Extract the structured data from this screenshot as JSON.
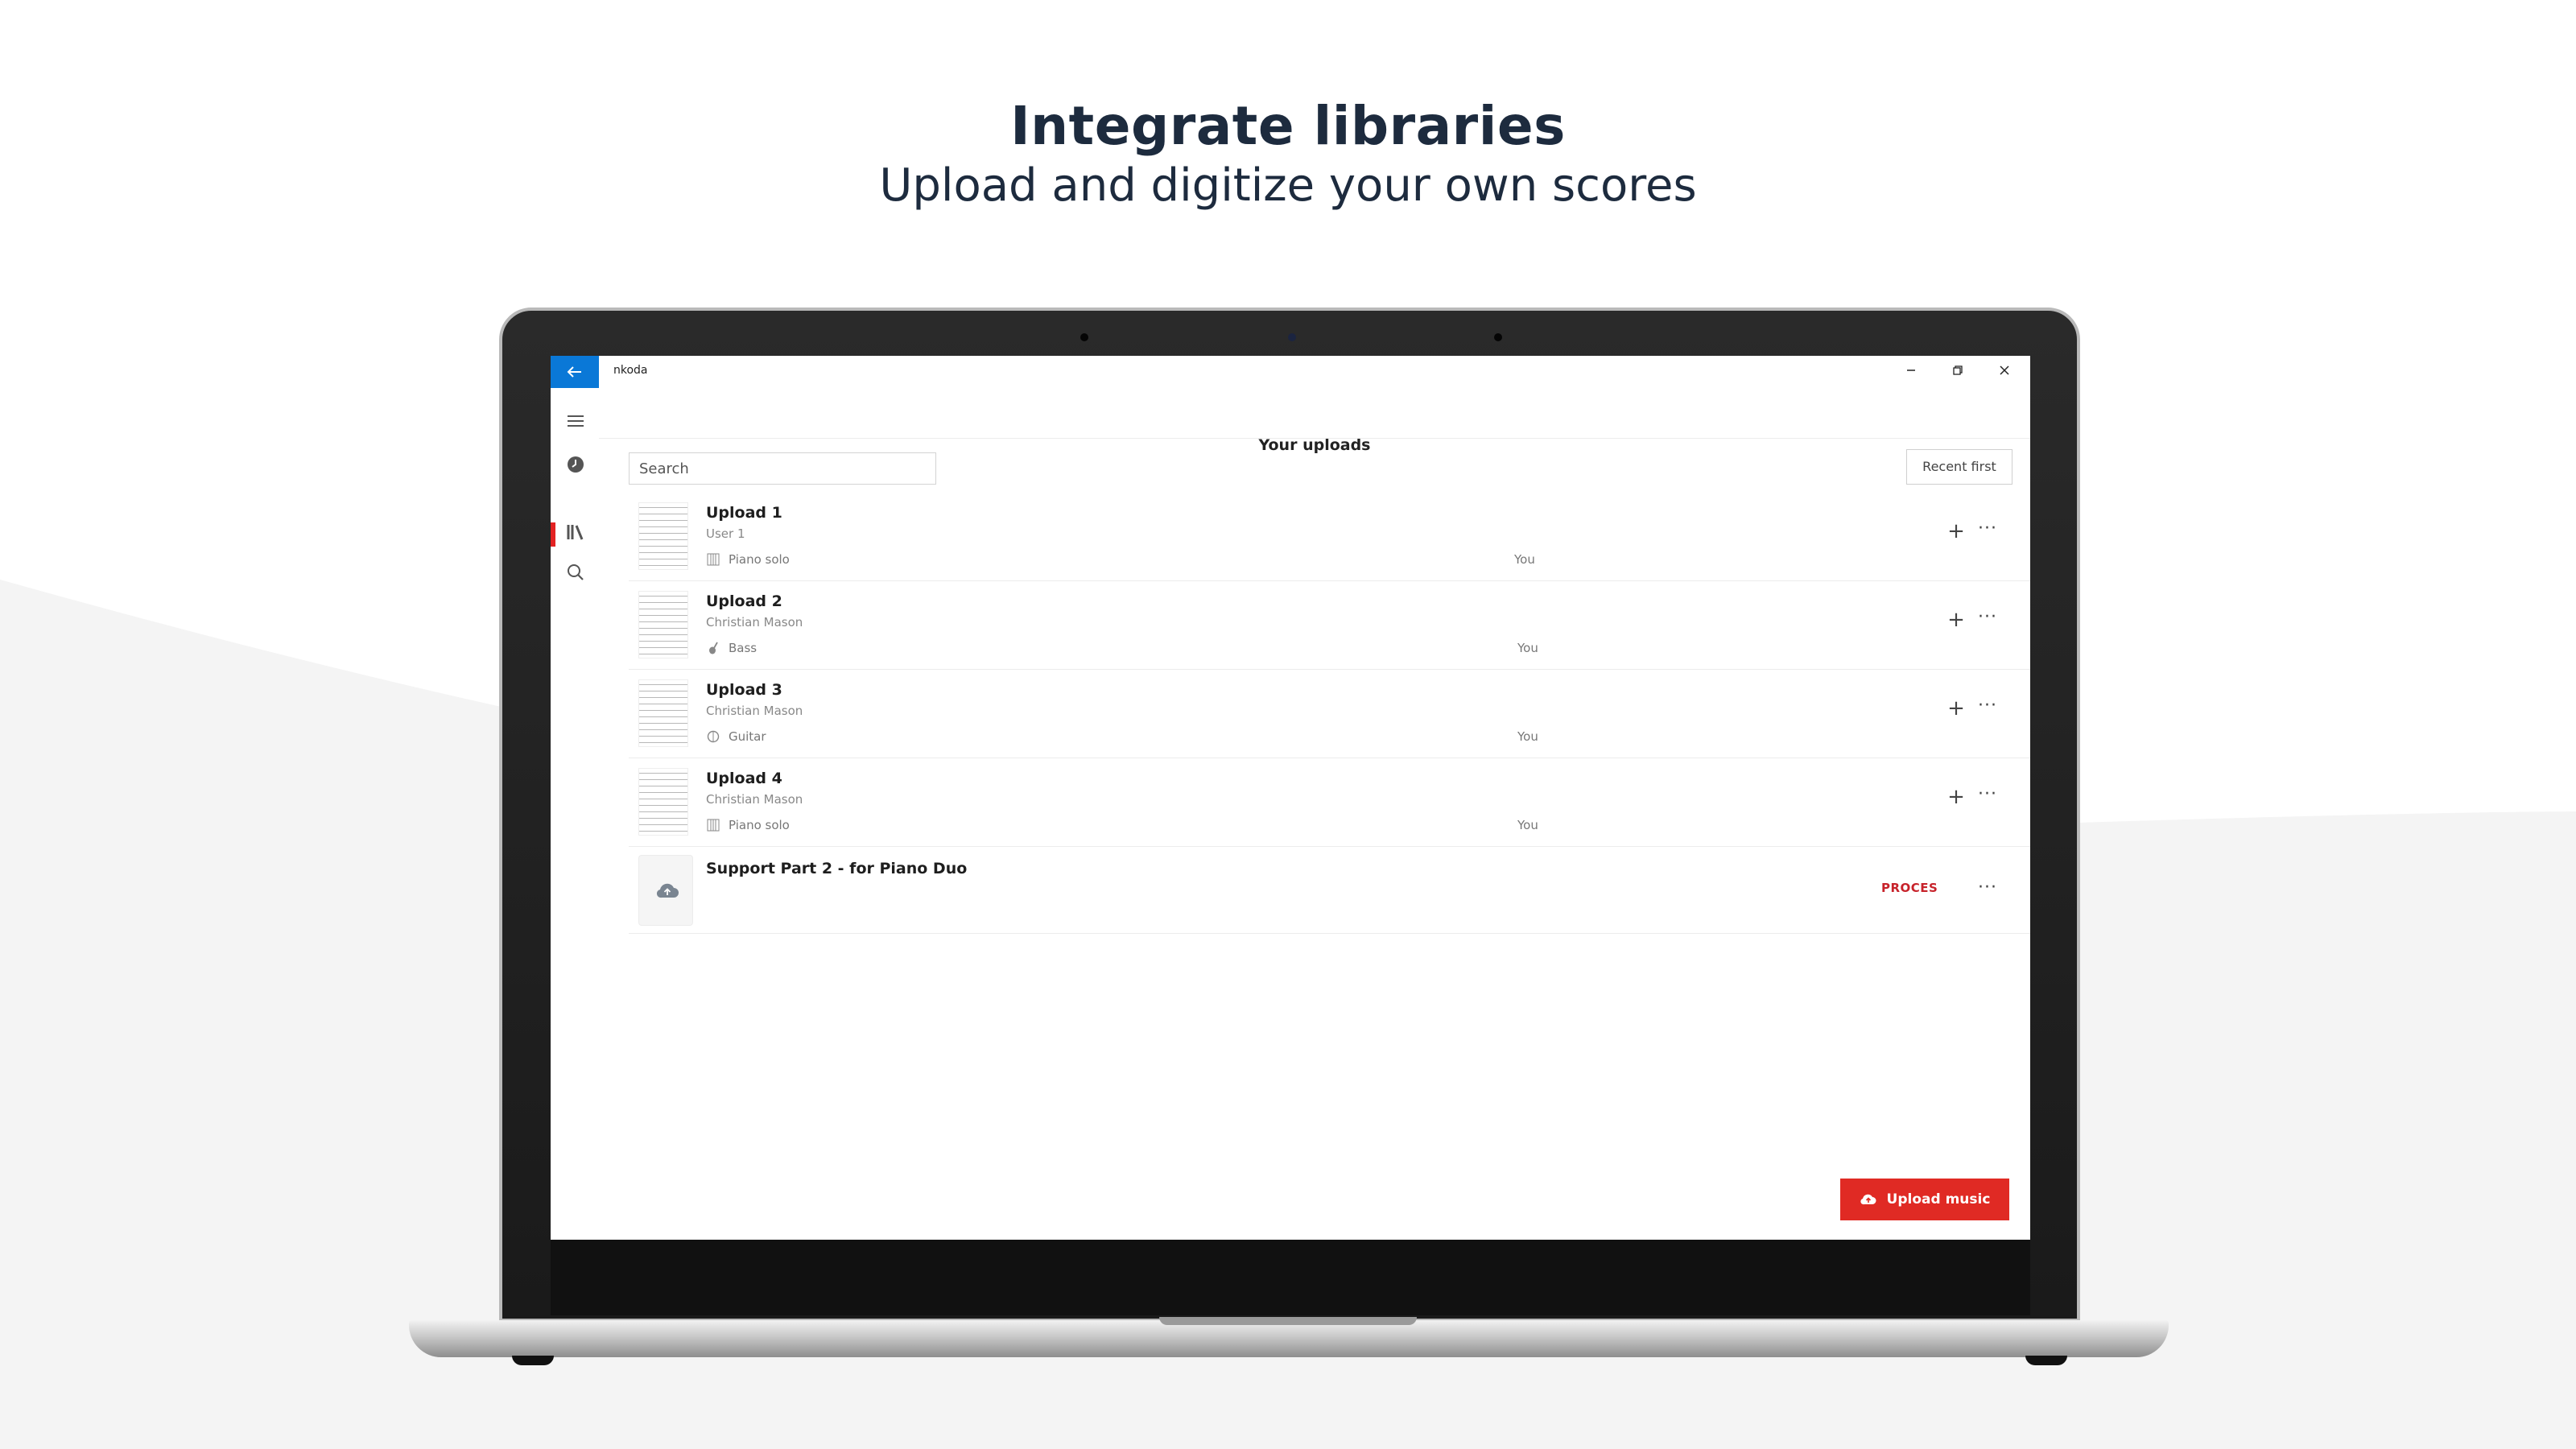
{
  "hero": {
    "title": "Integrate libraries",
    "subtitle": "Upload and digitize your own scores"
  },
  "window": {
    "app_name": "nkoda",
    "back_icon": "arrow-left-icon",
    "minimize_icon": "minimize-icon",
    "restore_icon": "restore-icon",
    "close_icon": "close-icon"
  },
  "sidebar": {
    "items": [
      {
        "icon": "hamburger-menu-icon"
      },
      {
        "icon": "clock-icon"
      },
      {
        "icon": "library-icon",
        "active": true
      },
      {
        "icon": "search-icon"
      }
    ],
    "active_color": "#e32222"
  },
  "page": {
    "title": "Your uploads",
    "search_placeholder": "Search",
    "sort_label": "Recent first"
  },
  "uploads": [
    {
      "title": "Upload 1",
      "author": "User 1",
      "instrument": "Piano solo",
      "instrument_icon": "piano-icon",
      "owner": "You"
    },
    {
      "title": "Upload 2",
      "author": "Christian Mason",
      "instrument": "Bass",
      "instrument_icon": "bass-icon",
      "owner": "You"
    },
    {
      "title": "Upload 3",
      "author": "Christian Mason",
      "instrument": "Guitar",
      "instrument_icon": "guitar-icon",
      "owner": "You"
    },
    {
      "title": "Upload 4",
      "author": "Christian Mason",
      "instrument": "Piano solo",
      "instrument_icon": "piano-icon",
      "owner": "You"
    }
  ],
  "processing_item": {
    "title": "Support Part 2 - for Piano Duo",
    "status": "PROCES",
    "icon": "cloud-upload-icon"
  },
  "actions": {
    "add_icon": "plus-icon",
    "more_icon": "more-dots-icon",
    "upload_label": "Upload music",
    "upload_icon": "cloud-upload-icon"
  },
  "colors": {
    "accent_blue": "#0a78d7",
    "accent_red": "#e02a24",
    "status_red": "#c7222a",
    "heading": "#1d2b3e"
  }
}
